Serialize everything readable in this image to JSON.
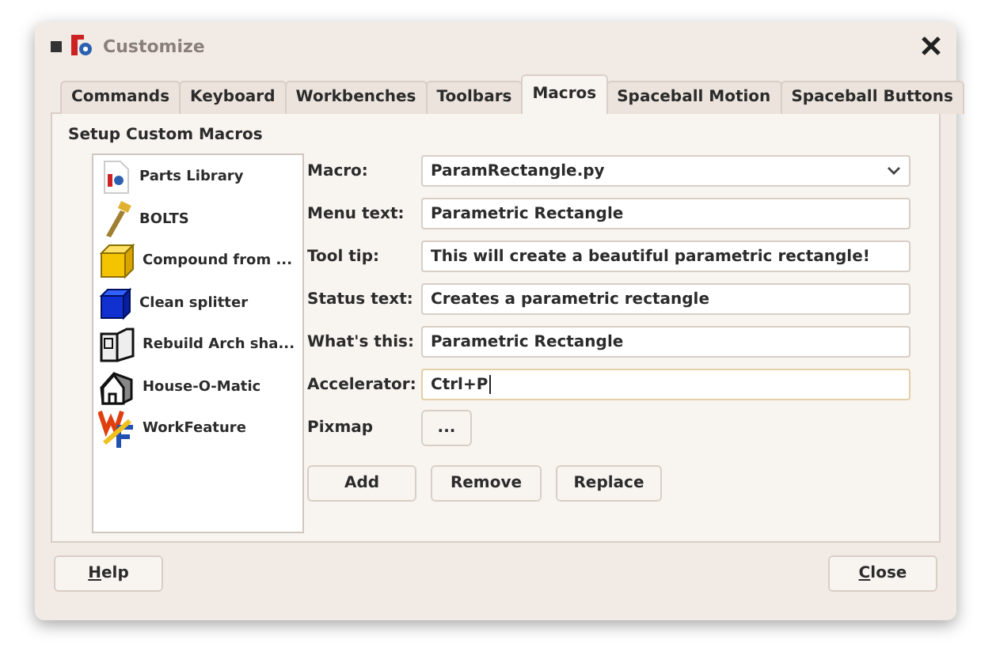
{
  "window": {
    "title": "Customize"
  },
  "tabs": [
    {
      "label": "Commands",
      "selected": false
    },
    {
      "label": "Keyboard",
      "selected": false
    },
    {
      "label": "Workbenches",
      "selected": false
    },
    {
      "label": "Toolbars",
      "selected": false
    },
    {
      "label": "Macros",
      "selected": true
    },
    {
      "label": "Spaceball Motion",
      "selected": false
    },
    {
      "label": "Spaceball Buttons",
      "selected": false
    }
  ],
  "group_title": "Setup Custom Macros",
  "macro_list": [
    {
      "label": "Parts Library"
    },
    {
      "label": "BOLTS"
    },
    {
      "label": "Compound from ..."
    },
    {
      "label": "Clean splitter"
    },
    {
      "label": "Rebuild Arch sha..."
    },
    {
      "label": "House-O-Matic"
    },
    {
      "label": "WorkFeature"
    }
  ],
  "fields": [
    {
      "kind": "dropdown",
      "label": "Macro:",
      "value": "ParamRectangle.py",
      "focused": false
    },
    {
      "kind": "text",
      "label": "Menu text:",
      "value": "Parametric Rectangle",
      "focused": false
    },
    {
      "kind": "text",
      "label": "Tool tip:",
      "value": "This will create a beautiful parametric rectangle!",
      "focused": false
    },
    {
      "kind": "text",
      "label": "Status text:",
      "value": "Creates a parametric rectangle",
      "focused": false
    },
    {
      "kind": "text",
      "label": "What's this:",
      "value": "Parametric Rectangle",
      "focused": false
    },
    {
      "kind": "text",
      "label": "Accelerator:",
      "value": "Ctrl+P",
      "focused": true
    },
    {
      "kind": "button",
      "label": "Pixmap",
      "value": "..."
    }
  ],
  "actions": [
    "Add",
    "Remove",
    "Replace"
  ],
  "footer": {
    "help": "Help",
    "close": "Close"
  }
}
